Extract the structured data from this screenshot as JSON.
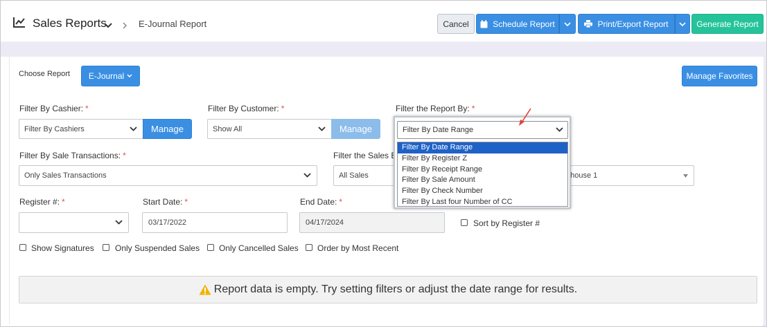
{
  "header": {
    "title": "Sales Reports",
    "breadcrumb": "E-Journal Report",
    "cancel_label": "Cancel",
    "schedule_label": "Schedule Report",
    "print_label": "Print/Export Report",
    "generate_label": "Generate Report"
  },
  "report": {
    "choose_label": "Choose Report",
    "selected": "E-Journal",
    "manage_favorites_label": "Manage Favorites"
  },
  "filters": {
    "cashier": {
      "label": "Filter By Cashier:",
      "value": "Filter By Cashiers",
      "manage_label": "Manage"
    },
    "customer": {
      "label": "Filter By Customer:",
      "value": "Show All",
      "manage_label": "Manage"
    },
    "report_by": {
      "label": "Filter the Report By:",
      "value": "Filter By Date Range",
      "options": [
        "Filter By Date Range",
        "Filter By Register Z",
        "Filter By Receipt Range",
        "Filter By Sale Amount",
        "Filter By Check Number",
        "Filter By Last four Number of CC"
      ]
    },
    "sale_transactions": {
      "label": "Filter By Sale Transactions:",
      "value": "Only Sales Transactions"
    },
    "sales_by": {
      "label": "Filter the Sales B",
      "value": "All Sales"
    },
    "warehouse": {
      "value": "ehouse 1"
    },
    "register": {
      "label": "Register #:",
      "value": ""
    },
    "start_date": {
      "label": "Start Date:",
      "value": "03/17/2022"
    },
    "end_date": {
      "label": "End Date:",
      "value": "04/17/2024"
    },
    "sort_by_register_label": "Sort by Register #"
  },
  "options": {
    "show_signatures": "Show Signatures",
    "only_suspended": "Only Suspended Sales",
    "only_cancelled": "Only Cancelled Sales",
    "order_recent": "Order by Most Recent"
  },
  "alert": {
    "message": "Report data is empty. Try setting filters or adjust the date range for results."
  },
  "colors": {
    "primary": "#3a8fe3",
    "success": "#25c39a",
    "selected": "#1e62c7",
    "required": "#d9534f",
    "warning": "#f0b400",
    "arrow": "#e0443a"
  },
  "icons": {
    "title": "line-chart-icon",
    "schedule": "calendar-icon",
    "print": "printer-icon",
    "alert": "warning-icon"
  }
}
